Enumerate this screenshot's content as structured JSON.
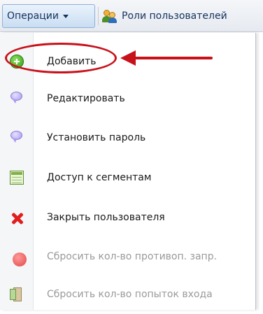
{
  "toolbar": {
    "operations_label": "Операции",
    "roles_label": "Роли пользователей"
  },
  "menu": {
    "items": [
      {
        "label": "Добавить",
        "icon": "add-icon",
        "enabled": true
      },
      {
        "label": "Редактировать",
        "icon": "edit-bubble-icon",
        "enabled": true
      },
      {
        "label": "Установить пароль",
        "icon": "password-bubble-icon",
        "enabled": true
      },
      {
        "label": "Доступ к сегментам",
        "icon": "table-icon",
        "enabled": true
      },
      {
        "label": "Закрыть пользователя",
        "icon": "close-x-icon",
        "enabled": true
      },
      {
        "label": "Сбросить кол-во противоп. запр.",
        "icon": "red-dot-icon",
        "enabled": false
      },
      {
        "label": "Сбросить кол-во попыток входа",
        "icon": "door-icon",
        "enabled": false
      }
    ]
  },
  "colors": {
    "annotation": "#c8121b",
    "toolbar_text": "#15325e",
    "disabled_text": "#9a9a9a"
  }
}
